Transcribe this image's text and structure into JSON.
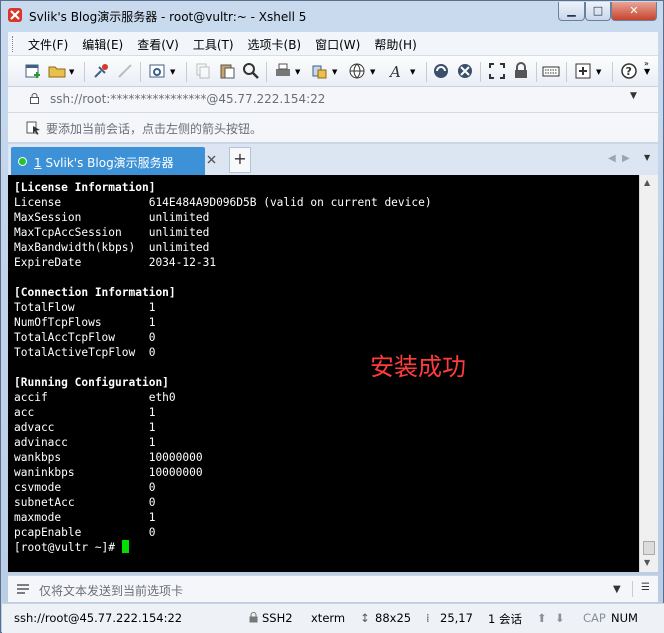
{
  "window": {
    "title": "Svlik's Blog演示服务器 - root@vultr:~ - Xshell 5"
  },
  "menu": [
    "文件(F)",
    "编辑(E)",
    "查看(V)",
    "工具(T)",
    "选项卡(B)",
    "窗口(W)",
    "帮助(H)"
  ],
  "address": {
    "text": "ssh://root:****************@45.77.222.154:22"
  },
  "hint": {
    "text": "要添加当前会话，点击左侧的箭头按钮。"
  },
  "tab": {
    "number": "1",
    "name": " Svlik's Blog演示服务器",
    "add_label": "+"
  },
  "terminal": {
    "lines": [
      "[License Information]",
      "License             614E484A9D096D5B (valid on current device)",
      "MaxSession          unlimited",
      "MaxTcpAccSession    unlimited",
      "MaxBandwidth(kbps)  unlimited",
      "ExpireDate          2034-12-31",
      "",
      "[Connection Information]",
      "TotalFlow           1",
      "NumOfTcpFlows       1",
      "TotalAccTcpFlow     0",
      "TotalActiveTcpFlow  0",
      "",
      "[Running Configuration]",
      "accif               eth0",
      "acc                 1",
      "advacc              1",
      "advinacc            1",
      "wankbps             10000000",
      "waninkbps           10000000",
      "csvmode             0",
      "subnetAcc           0",
      "maxmode             1",
      "pcapEnable          0"
    ],
    "prompt": "[root@vultr ~]# ",
    "overlay": "安装成功",
    "cursor_color": "#00e000"
  },
  "send": {
    "placeholder": "仅将文本发送到当前选项卡"
  },
  "status": {
    "connection": "ssh://root@45.77.222.154:22",
    "protocol": "SSH2",
    "term": "xterm",
    "size": "88x25",
    "position": "25,17",
    "sessions": "1 会话",
    "cap": "CAP",
    "num": "NUM"
  },
  "colors": {
    "tab_active": "#3d91d6",
    "terminal_bg": "#000000",
    "overlay_text": "#ff3b3b"
  }
}
